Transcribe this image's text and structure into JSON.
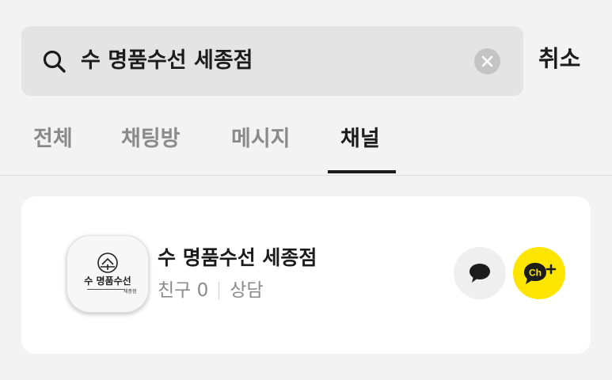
{
  "search": {
    "query": "수 명품수선 세종점",
    "cancel_label": "취소"
  },
  "tabs": [
    {
      "label": "전체",
      "active": false
    },
    {
      "label": "채팅방",
      "active": false
    },
    {
      "label": "메시지",
      "active": false
    },
    {
      "label": "채널",
      "active": true
    }
  ],
  "results": [
    {
      "channel_name": "수 명품수선 세종점",
      "friends_label": "친구 0",
      "consult_label": "상담",
      "profile_name": "수 명품수선",
      "profile_sub": "세종점",
      "actions": [
        "chat-bubble-icon",
        "channel-add-icon"
      ]
    }
  ],
  "colors": {
    "background": "#f3f3f3",
    "search_bg": "#e4e4e4",
    "brand_yellow": "#fee500",
    "text_primary": "#1c1c1c",
    "text_muted": "#8a8a8a"
  }
}
